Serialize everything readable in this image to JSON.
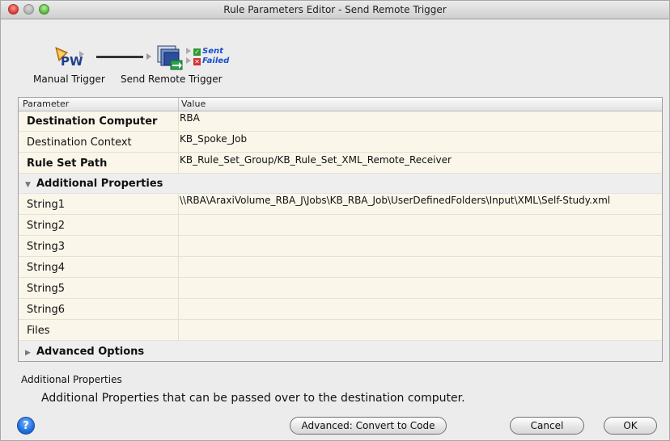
{
  "window": {
    "title": "Rule Parameters Editor - Send Remote Trigger"
  },
  "flow": {
    "source_label": "Manual Trigger",
    "target_label": "Send Remote Trigger",
    "outputs": [
      {
        "label": "Sent",
        "status_color": "#2f9a2f"
      },
      {
        "label": "Failed",
        "status_color": "#d43030"
      }
    ],
    "source_icon": "pw-trigger-icon",
    "target_icon": "send-remote-trigger-icon"
  },
  "table": {
    "headers": {
      "parameter": "Parameter",
      "value": "Value"
    },
    "rows": [
      {
        "name": "Destination Computer",
        "value": "RBA"
      },
      {
        "name": "Destination Context",
        "value": "KB_Spoke_Job"
      },
      {
        "name": "Rule Set Path",
        "value": "KB_Rule_Set_Group/KB_Rule_Set_XML_Remote_Receiver"
      }
    ],
    "additional_group": "Additional Properties",
    "additional_rows": [
      {
        "name": "String1",
        "value": "\\\\RBA\\AraxiVolume_RBA_J\\Jobs\\KB_RBA_Job\\UserDefinedFolders\\Input\\XML\\Self-Study.xml"
      },
      {
        "name": "String2",
        "value": ""
      },
      {
        "name": "String3",
        "value": ""
      },
      {
        "name": "String4",
        "value": ""
      },
      {
        "name": "String5",
        "value": ""
      },
      {
        "name": "String6",
        "value": ""
      },
      {
        "name": "Files",
        "value": ""
      }
    ],
    "advanced_group": "Advanced Options"
  },
  "help": {
    "title": "Additional Properties",
    "description": "Additional Properties that can be passed over to the destination computer."
  },
  "buttons": {
    "help": "?",
    "convert": "Advanced: Convert to Code",
    "cancel": "Cancel",
    "ok": "OK"
  }
}
